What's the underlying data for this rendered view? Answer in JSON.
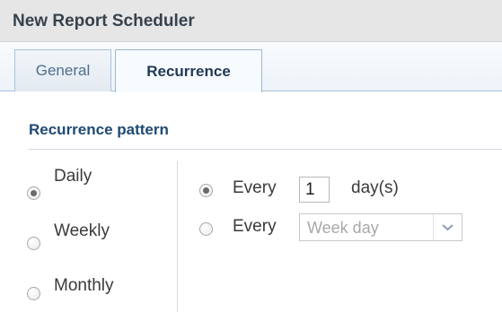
{
  "window": {
    "title": "New Report Scheduler"
  },
  "tabs": [
    {
      "label": "General",
      "active": false
    },
    {
      "label": "Recurrence",
      "active": true
    }
  ],
  "recurrence": {
    "section_title": "Recurrence pattern",
    "pattern_options": [
      {
        "label": "Daily",
        "checked": true
      },
      {
        "label": "Weekly",
        "checked": false
      },
      {
        "label": "Monthly",
        "checked": false
      }
    ],
    "daily": {
      "every_days_label": "Every",
      "every_days_value": "1",
      "days_unit": "day(s)",
      "every_weekday_label": "Every",
      "weekday_select_value": "Week day"
    }
  },
  "icons": {
    "select_arrow": "chevron-down-icon"
  },
  "colors": {
    "title_bar": "#e6e6e6",
    "section_title": "#1f4a73",
    "tab_border": "#a9c3db"
  }
}
